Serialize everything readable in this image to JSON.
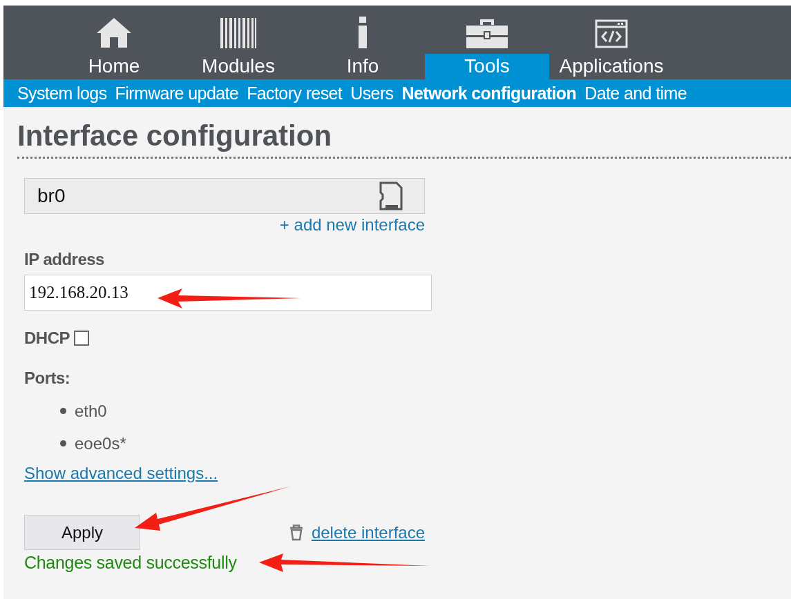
{
  "nav": {
    "tabs": [
      {
        "label": "Home",
        "kind": "home",
        "selected": false
      },
      {
        "label": "Modules",
        "kind": "bars",
        "selected": false
      },
      {
        "label": "Info",
        "kind": "info",
        "selected": false
      },
      {
        "label": "Tools",
        "kind": "toolbox",
        "selected": true
      },
      {
        "label": "Applications",
        "kind": "code",
        "selected": false
      }
    ]
  },
  "subnav": [
    {
      "label": "System logs",
      "selected": false
    },
    {
      "label": "Firmware update",
      "selected": false
    },
    {
      "label": "Factory reset",
      "selected": false
    },
    {
      "label": "Users",
      "selected": false
    },
    {
      "label": "Network configuration",
      "selected": true
    },
    {
      "label": "Date and time",
      "selected": false
    }
  ],
  "title": "Interface configuration",
  "interface": {
    "name": "br0"
  },
  "add_link": "+ add new interface",
  "ip": {
    "label": "IP address",
    "value": "192.168.20.13"
  },
  "dhcp": {
    "label": "DHCP",
    "checked": false
  },
  "ports": {
    "label": "Ports:",
    "items": [
      "eth0",
      "eoe0s*"
    ]
  },
  "advanced_link": "Show advanced settings...",
  "apply_button": "Apply",
  "delete_link": "delete interface",
  "status": "Changes saved successfully"
}
